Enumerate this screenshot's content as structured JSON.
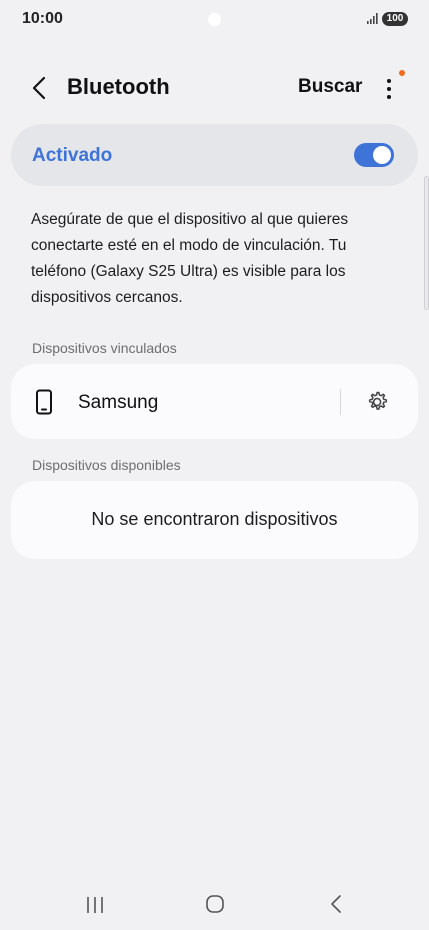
{
  "status_bar": {
    "time": "10:00",
    "battery": "100",
    "icons": [
      "signal-icon",
      "battery-icon"
    ]
  },
  "header": {
    "title": "Bluetooth",
    "action": "Buscar",
    "icons": [
      "back-arrow-icon",
      "more-options-icon"
    ]
  },
  "bluetooth_toggle": {
    "label": "Activado",
    "state": "on"
  },
  "description": "Asegúrate de que el dispositivo al que quieres conectarte esté en el modo de vinculación. Tu teléfono (Galaxy S25 Ultra) es visible para los dispositivos cercanos.",
  "paired_devices": {
    "heading": "Dispositivos vinculados",
    "items": [
      {
        "name": "Samsung",
        "icon": "phone-icon",
        "settings_icon": "gear-icon"
      }
    ]
  },
  "available_devices": {
    "heading": "Dispositivos disponibles",
    "empty_message": "No se encontraron dispositivos"
  },
  "nav_bar": {
    "icons": [
      "recent-apps-icon",
      "home-icon",
      "back-icon"
    ]
  },
  "colors": {
    "accent": "#3e73d8",
    "background": "#f1f1f3",
    "card": "#fbfbfd",
    "notification_dot": "#f26b1d"
  }
}
